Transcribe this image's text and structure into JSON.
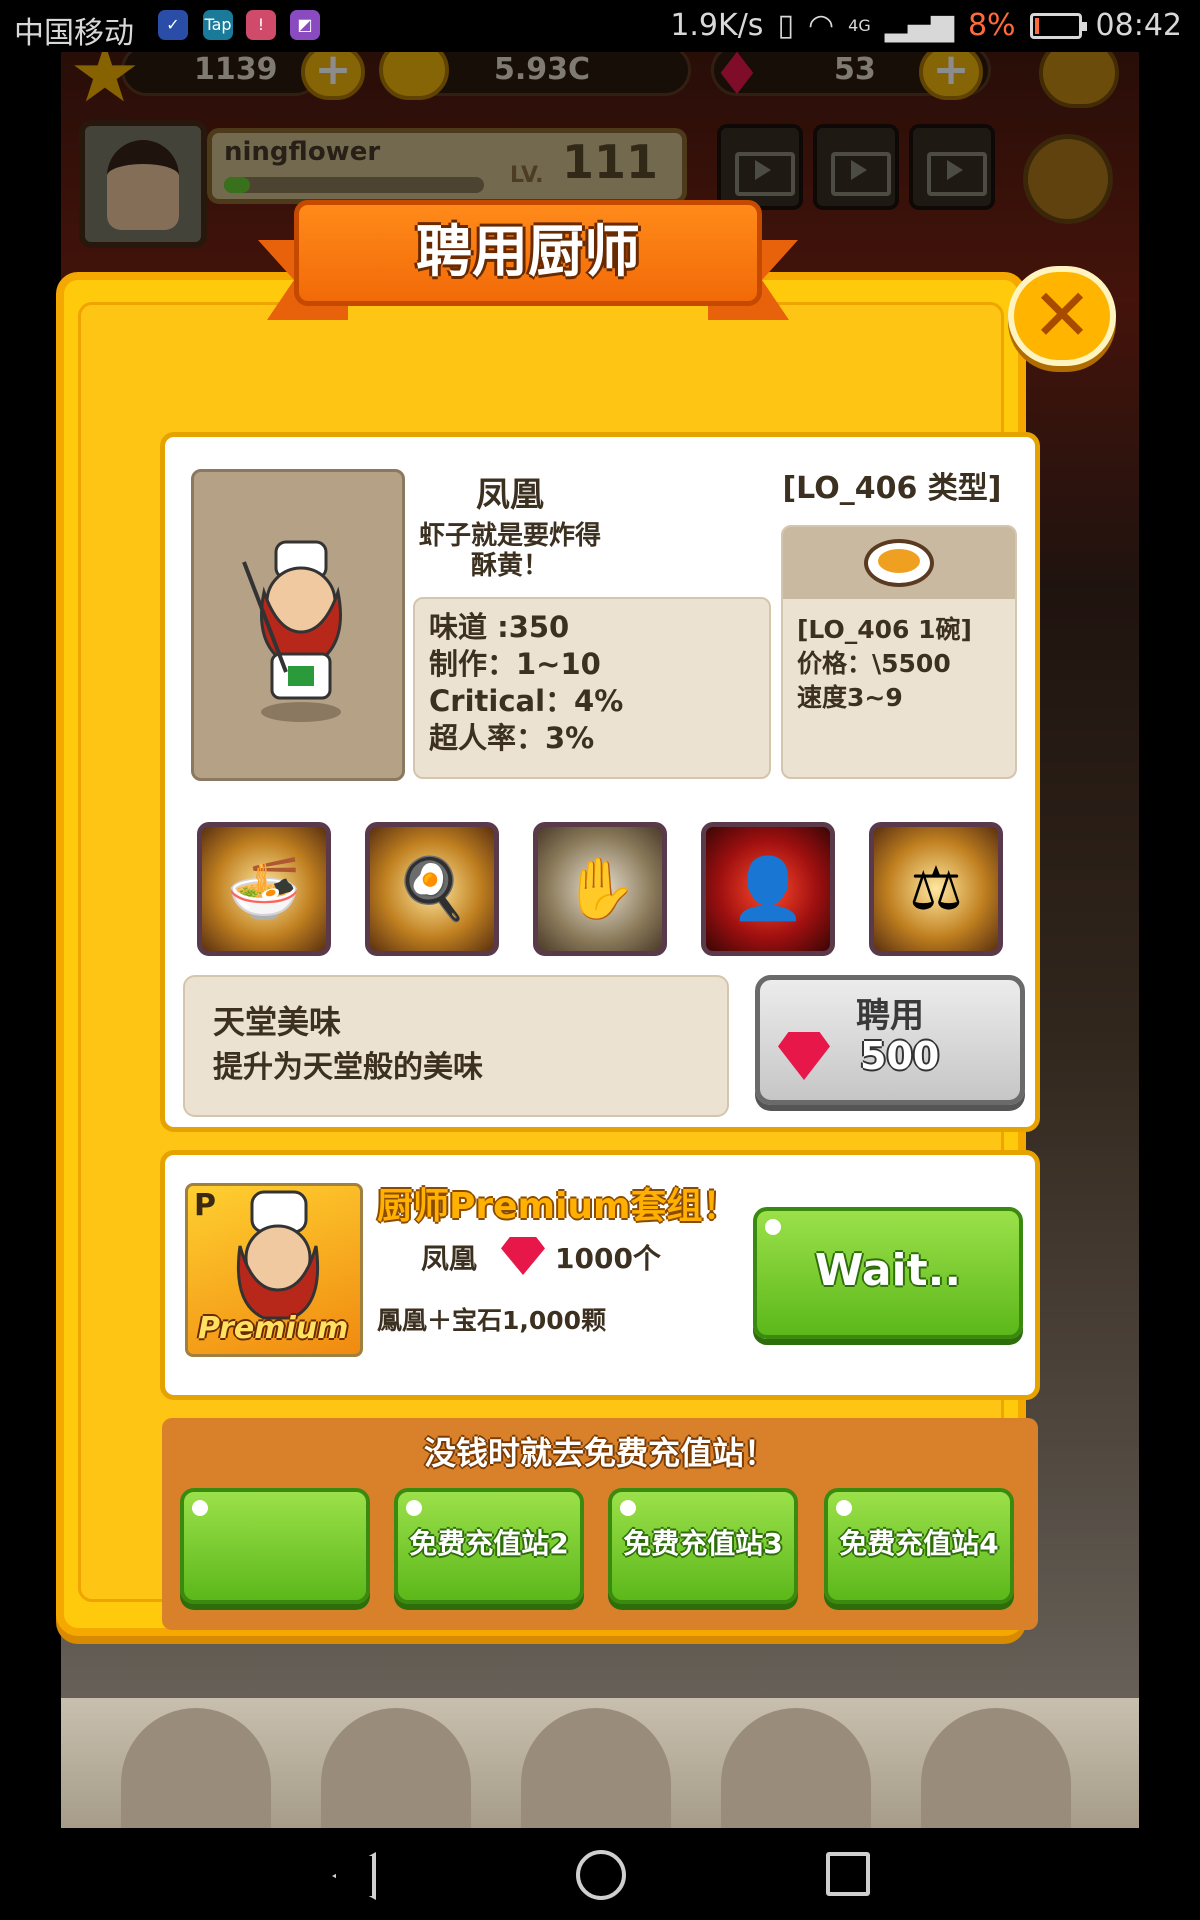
{
  "status_bar": {
    "carrier": "中国移动",
    "net_speed": "1.9K/s",
    "network": "4G",
    "battery": "8%",
    "time": "08:42",
    "notification_icons": [
      "shield-icon",
      "tap-icon",
      "red-app-icon",
      "purple-app-icon"
    ]
  },
  "hud": {
    "stars": "1139",
    "coins": "5.93C",
    "gems": "53"
  },
  "player": {
    "name": "ningflower",
    "level_label": "LV.",
    "level": "111",
    "xp_fraction": 0.1
  },
  "dialog": {
    "title": "聘用厨师",
    "close_label": "✕"
  },
  "chef": {
    "name": "凤凰",
    "description": "虾子就是要炸得酥黄！",
    "type_label": "[LO_406 类型]",
    "stats": {
      "taste": "味道 :350",
      "make": "制作：1~10",
      "critical": "Critical：4%",
      "super": "超人率：3%"
    },
    "dish": {
      "name": "[LO_406 1碗]",
      "price": "价格：\\5500",
      "speed": "速度3~9"
    },
    "skills": [
      "noodle-bowl-icon",
      "frying-pan-icon",
      "hand-swirl-icon",
      "dark-chef-icon",
      "scale-icon"
    ],
    "selected_skill": {
      "title": "天堂美味",
      "description": "提升为天堂般的美味"
    },
    "hire": {
      "label": "聘用",
      "price": "500"
    }
  },
  "premium": {
    "badge": "P",
    "image_text": "Premium",
    "title": "厨师Premium套组！",
    "chef": "凤凰",
    "gem_count": "1000个",
    "subtitle": "鳳凰＋宝石1,000颗",
    "button": "Wait.."
  },
  "free_charge": {
    "title": "没钱时就去免费充值站！",
    "buttons": [
      "",
      "免费充值站2",
      "免费充值站3",
      "免费充值站4"
    ]
  },
  "colors": {
    "dialog_yellow": "#ffc90c",
    "title_orange": "#f26a08",
    "button_green": "#5cb81a",
    "gem_red": "#e8174a"
  }
}
